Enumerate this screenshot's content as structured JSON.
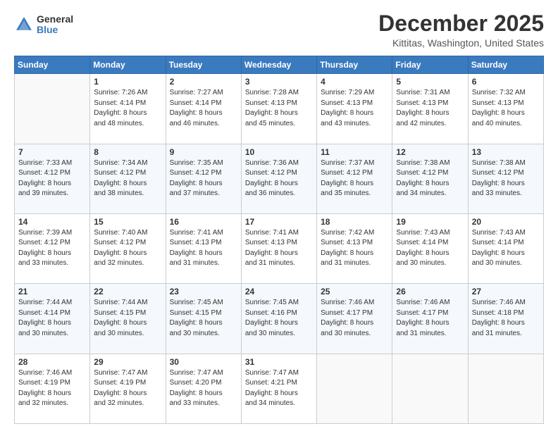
{
  "header": {
    "logo_general": "General",
    "logo_blue": "Blue",
    "title": "December 2025",
    "subtitle": "Kittitas, Washington, United States"
  },
  "calendar": {
    "days_of_week": [
      "Sunday",
      "Monday",
      "Tuesday",
      "Wednesday",
      "Thursday",
      "Friday",
      "Saturday"
    ],
    "weeks": [
      [
        {
          "day": "",
          "info": ""
        },
        {
          "day": "1",
          "info": "Sunrise: 7:26 AM\nSunset: 4:14 PM\nDaylight: 8 hours\nand 48 minutes."
        },
        {
          "day": "2",
          "info": "Sunrise: 7:27 AM\nSunset: 4:14 PM\nDaylight: 8 hours\nand 46 minutes."
        },
        {
          "day": "3",
          "info": "Sunrise: 7:28 AM\nSunset: 4:13 PM\nDaylight: 8 hours\nand 45 minutes."
        },
        {
          "day": "4",
          "info": "Sunrise: 7:29 AM\nSunset: 4:13 PM\nDaylight: 8 hours\nand 43 minutes."
        },
        {
          "day": "5",
          "info": "Sunrise: 7:31 AM\nSunset: 4:13 PM\nDaylight: 8 hours\nand 42 minutes."
        },
        {
          "day": "6",
          "info": "Sunrise: 7:32 AM\nSunset: 4:13 PM\nDaylight: 8 hours\nand 40 minutes."
        }
      ],
      [
        {
          "day": "7",
          "info": "Sunrise: 7:33 AM\nSunset: 4:12 PM\nDaylight: 8 hours\nand 39 minutes."
        },
        {
          "day": "8",
          "info": "Sunrise: 7:34 AM\nSunset: 4:12 PM\nDaylight: 8 hours\nand 38 minutes."
        },
        {
          "day": "9",
          "info": "Sunrise: 7:35 AM\nSunset: 4:12 PM\nDaylight: 8 hours\nand 37 minutes."
        },
        {
          "day": "10",
          "info": "Sunrise: 7:36 AM\nSunset: 4:12 PM\nDaylight: 8 hours\nand 36 minutes."
        },
        {
          "day": "11",
          "info": "Sunrise: 7:37 AM\nSunset: 4:12 PM\nDaylight: 8 hours\nand 35 minutes."
        },
        {
          "day": "12",
          "info": "Sunrise: 7:38 AM\nSunset: 4:12 PM\nDaylight: 8 hours\nand 34 minutes."
        },
        {
          "day": "13",
          "info": "Sunrise: 7:38 AM\nSunset: 4:12 PM\nDaylight: 8 hours\nand 33 minutes."
        }
      ],
      [
        {
          "day": "14",
          "info": "Sunrise: 7:39 AM\nSunset: 4:12 PM\nDaylight: 8 hours\nand 33 minutes."
        },
        {
          "day": "15",
          "info": "Sunrise: 7:40 AM\nSunset: 4:12 PM\nDaylight: 8 hours\nand 32 minutes."
        },
        {
          "day": "16",
          "info": "Sunrise: 7:41 AM\nSunset: 4:13 PM\nDaylight: 8 hours\nand 31 minutes."
        },
        {
          "day": "17",
          "info": "Sunrise: 7:41 AM\nSunset: 4:13 PM\nDaylight: 8 hours\nand 31 minutes."
        },
        {
          "day": "18",
          "info": "Sunrise: 7:42 AM\nSunset: 4:13 PM\nDaylight: 8 hours\nand 31 minutes."
        },
        {
          "day": "19",
          "info": "Sunrise: 7:43 AM\nSunset: 4:14 PM\nDaylight: 8 hours\nand 30 minutes."
        },
        {
          "day": "20",
          "info": "Sunrise: 7:43 AM\nSunset: 4:14 PM\nDaylight: 8 hours\nand 30 minutes."
        }
      ],
      [
        {
          "day": "21",
          "info": "Sunrise: 7:44 AM\nSunset: 4:14 PM\nDaylight: 8 hours\nand 30 minutes."
        },
        {
          "day": "22",
          "info": "Sunrise: 7:44 AM\nSunset: 4:15 PM\nDaylight: 8 hours\nand 30 minutes."
        },
        {
          "day": "23",
          "info": "Sunrise: 7:45 AM\nSunset: 4:15 PM\nDaylight: 8 hours\nand 30 minutes."
        },
        {
          "day": "24",
          "info": "Sunrise: 7:45 AM\nSunset: 4:16 PM\nDaylight: 8 hours\nand 30 minutes."
        },
        {
          "day": "25",
          "info": "Sunrise: 7:46 AM\nSunset: 4:17 PM\nDaylight: 8 hours\nand 30 minutes."
        },
        {
          "day": "26",
          "info": "Sunrise: 7:46 AM\nSunset: 4:17 PM\nDaylight: 8 hours\nand 31 minutes."
        },
        {
          "day": "27",
          "info": "Sunrise: 7:46 AM\nSunset: 4:18 PM\nDaylight: 8 hours\nand 31 minutes."
        }
      ],
      [
        {
          "day": "28",
          "info": "Sunrise: 7:46 AM\nSunset: 4:19 PM\nDaylight: 8 hours\nand 32 minutes."
        },
        {
          "day": "29",
          "info": "Sunrise: 7:47 AM\nSunset: 4:19 PM\nDaylight: 8 hours\nand 32 minutes."
        },
        {
          "day": "30",
          "info": "Sunrise: 7:47 AM\nSunset: 4:20 PM\nDaylight: 8 hours\nand 33 minutes."
        },
        {
          "day": "31",
          "info": "Sunrise: 7:47 AM\nSunset: 4:21 PM\nDaylight: 8 hours\nand 34 minutes."
        },
        {
          "day": "",
          "info": ""
        },
        {
          "day": "",
          "info": ""
        },
        {
          "day": "",
          "info": ""
        }
      ]
    ]
  }
}
